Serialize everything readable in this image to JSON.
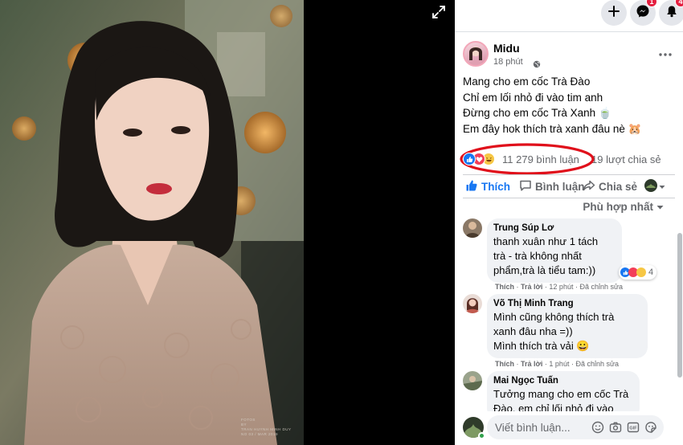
{
  "viewer": {
    "expand_icon": "expand-icon",
    "photo_credit": "FOTOS\nBY\nTRAN HUYNH MINH DUY\nNO 03 / MAR 2019"
  },
  "topbar": {
    "create_icon": "plus-icon",
    "messenger_icon": "messenger-icon",
    "messenger_badge": "1",
    "notifications_icon": "bell-icon",
    "notifications_badge": "4"
  },
  "post": {
    "author": "Midu",
    "time": "18 phút",
    "audience_icon": "globe-icon",
    "more_icon": "more-horizontal-icon",
    "lines": [
      "Mang cho em cốc Trà Đào",
      "Chỉ em lối nhỏ đi vào tim anh",
      "Đừng cho em cốc Trà Xanh 🍵",
      "Em đây hok thích trà xanh đâu nè 🐹"
    ],
    "reactions": [
      "like",
      "love",
      "haha"
    ],
    "comments_count": "11 279 bình luận",
    "shares_count": "19 lượt chia sẻ"
  },
  "actions": {
    "like": "Thích",
    "comment": "Bình luận",
    "share": "Chia sẻ"
  },
  "sort_label": "Phù hợp nhất",
  "comments": [
    {
      "name": "Trung Súp Lơ",
      "lines": [
        "thanh xuân như 1 tách",
        "trà - trà không nhất",
        "phẩm,trà là tiểu tam:))"
      ],
      "reaction_count": "4",
      "meta_like": "Thích",
      "meta_reply": "Trả lời",
      "meta_time": "12 phút",
      "meta_edited": "Đã chỉnh sửa"
    },
    {
      "name": "Võ Thị Minh Trang",
      "lines": [
        "Mình cũng không thích trà",
        "xanh đâu nha =))",
        "Mình thích trà vải 😀"
      ],
      "meta_like": "Thích",
      "meta_reply": "Trả lời",
      "meta_time": "1 phút",
      "meta_edited": "Đã chỉnh sửa"
    },
    {
      "name": "Mai Ngọc Tuấn",
      "lines": [
        "Tưởng mang cho em cốc Trà",
        "Đào, em chỉ lối nhỏ đi vào"
      ]
    }
  ],
  "composer": {
    "placeholder": "Viết bình luận...",
    "icons": [
      "emoji-icon",
      "camera-icon",
      "gif-icon",
      "sticker-icon"
    ]
  },
  "colors": {
    "facebook_blue": "#1877f2",
    "highlight_red": "#e0101b",
    "badge_red": "#e41e3f"
  }
}
